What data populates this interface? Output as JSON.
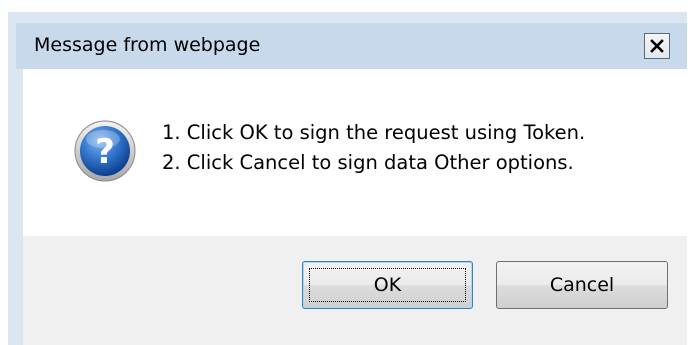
{
  "dialog": {
    "title": "Message from webpage",
    "close_label": "✕",
    "icon": "question-icon",
    "message_lines": [
      "1. Click OK to sign the request using Token.",
      "2. Click Cancel to sign data Other options."
    ],
    "buttons": {
      "ok_label": "OK",
      "cancel_label": "Cancel"
    }
  },
  "colors": {
    "titlebar": "#c7d9ea",
    "frame": "#dbe6f1",
    "footer": "#f0f0f0",
    "icon_blue": "#1f5fb8"
  }
}
